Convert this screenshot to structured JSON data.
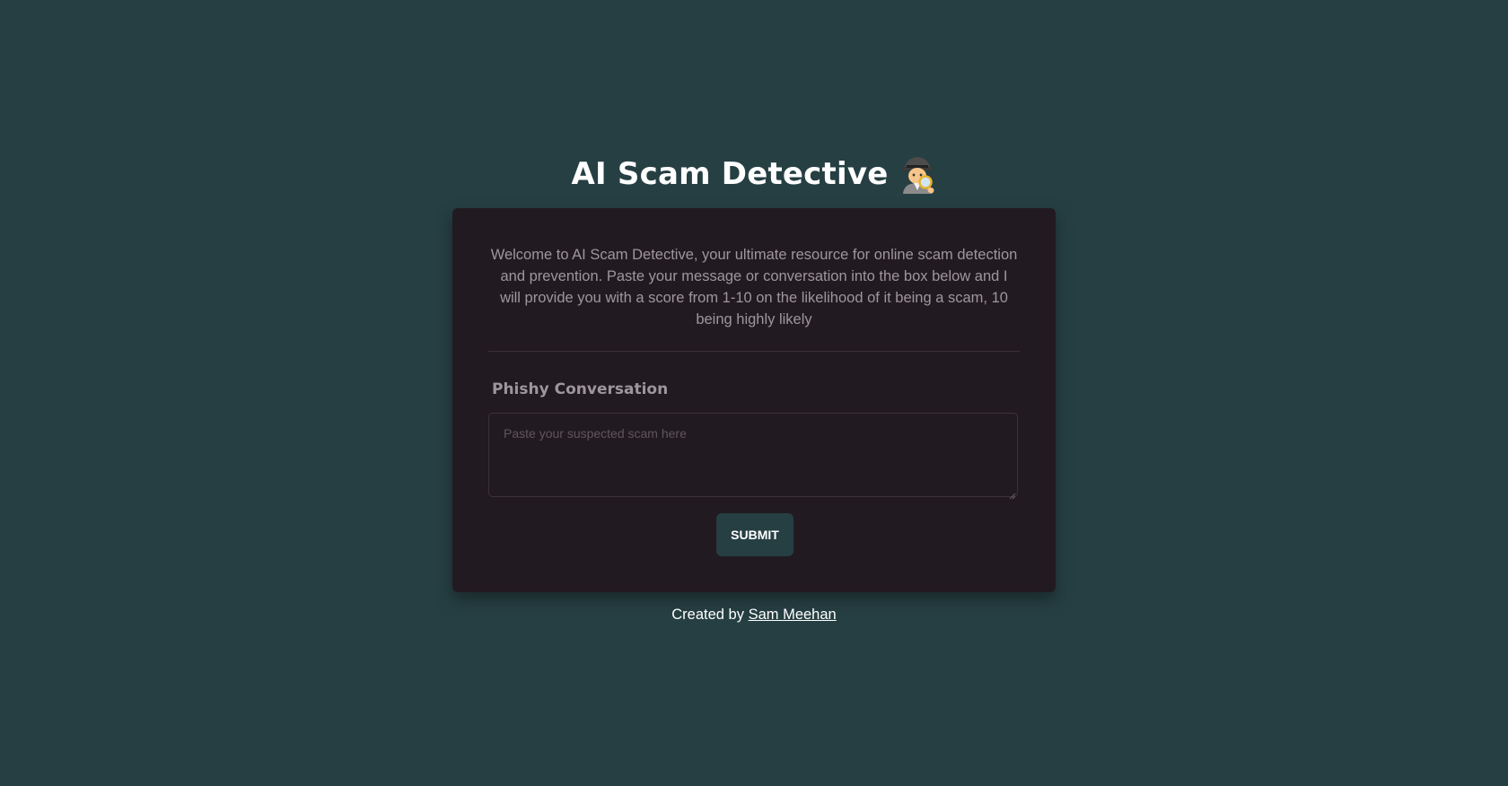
{
  "header": {
    "title": "AI Scam Detective",
    "icon": "detective-emoji"
  },
  "card": {
    "intro": "Welcome to AI Scam Detective, your ultimate resource for online scam detection and prevention. Paste your message or conversation into the box below and I will provide you with a score from 1-10 on the likelihood of it being a scam, 10 being highly likely",
    "field_label": "Phishy Conversation",
    "textarea_placeholder": "Paste your suspected scam here",
    "textarea_value": "",
    "submit_label": "SUBMIT"
  },
  "footer": {
    "prefix": "Created by",
    "author": "Sam Meehan"
  },
  "colors": {
    "background": "#263f43",
    "card": "#221a21",
    "muted_text": "#9d979d",
    "button": "#263f43"
  }
}
